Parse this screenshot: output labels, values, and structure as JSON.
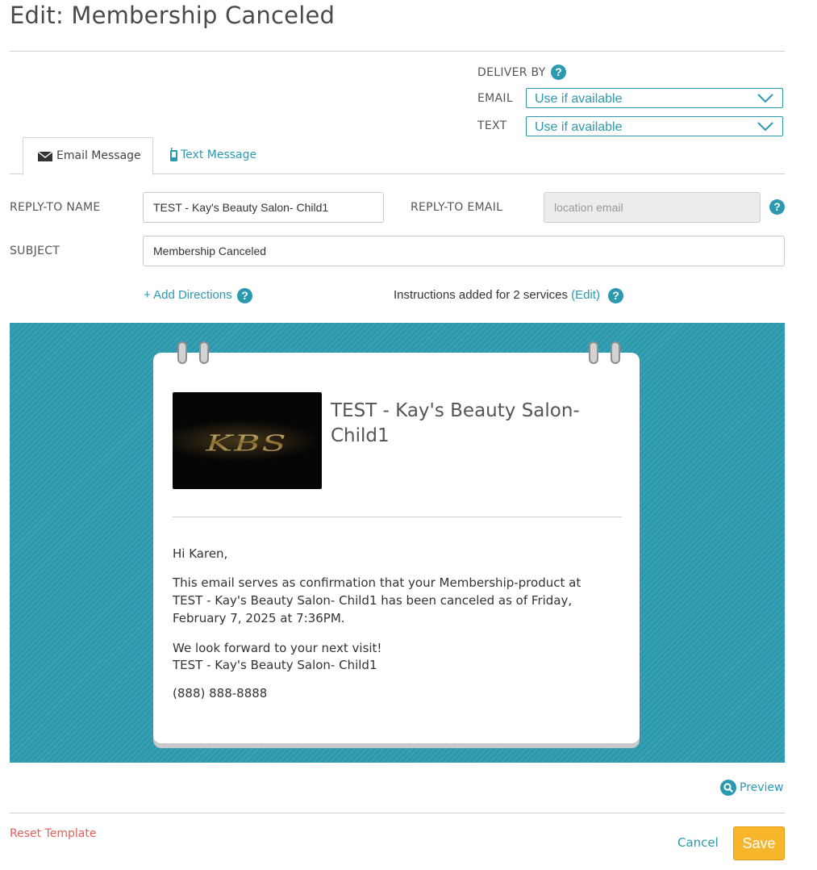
{
  "page": {
    "title": "Edit: Membership Canceled"
  },
  "deliver": {
    "label": "DELIVER BY",
    "email_label": "EMAIL",
    "email_value": "Use if available",
    "text_label": "TEXT",
    "text_value": "Use if available"
  },
  "tabs": [
    {
      "label": "Email Message",
      "icon": "envelope-icon",
      "active": true
    },
    {
      "label": "Text Message",
      "icon": "mobile-phone-icon",
      "active": false
    }
  ],
  "form": {
    "reply_to_name_label": "REPLY-TO NAME",
    "reply_to_name_value": "TEST - Kay's Beauty Salon- Child1",
    "reply_to_email_label": "REPLY-TO EMAIL",
    "reply_to_email_placeholder": "location email",
    "subject_label": "SUBJECT",
    "subject_value": "Membership Canceled"
  },
  "directions": {
    "add_label": "+ Add Directions",
    "instructions_text": "Instructions added for 2 services",
    "edit_label": "(Edit)"
  },
  "preview_card": {
    "business_name": "TEST - Kay's Beauty Salon- Child1",
    "logo_text": "KBS",
    "greeting": "Hi Karen,",
    "body": "This email serves as confirmation that your Membership-product at TEST - Kay's Beauty Salon- Child1 has been canceled as of Friday, February 7, 2025 at 7:36PM.",
    "closing_line1": "We look forward to your next visit!",
    "closing_line2": "TEST - Kay's Beauty Salon- Child1",
    "phone": "(888) 888-8888"
  },
  "footer": {
    "preview_label": "Preview",
    "reset_label": "Reset Template",
    "cancel_label": "Cancel",
    "save_label": "Save"
  },
  "colors": {
    "accent": "#2b9ab0",
    "hero_bg": "#2e9db1",
    "save_bg": "#f7b52b",
    "reset_text": "#e0605a"
  }
}
